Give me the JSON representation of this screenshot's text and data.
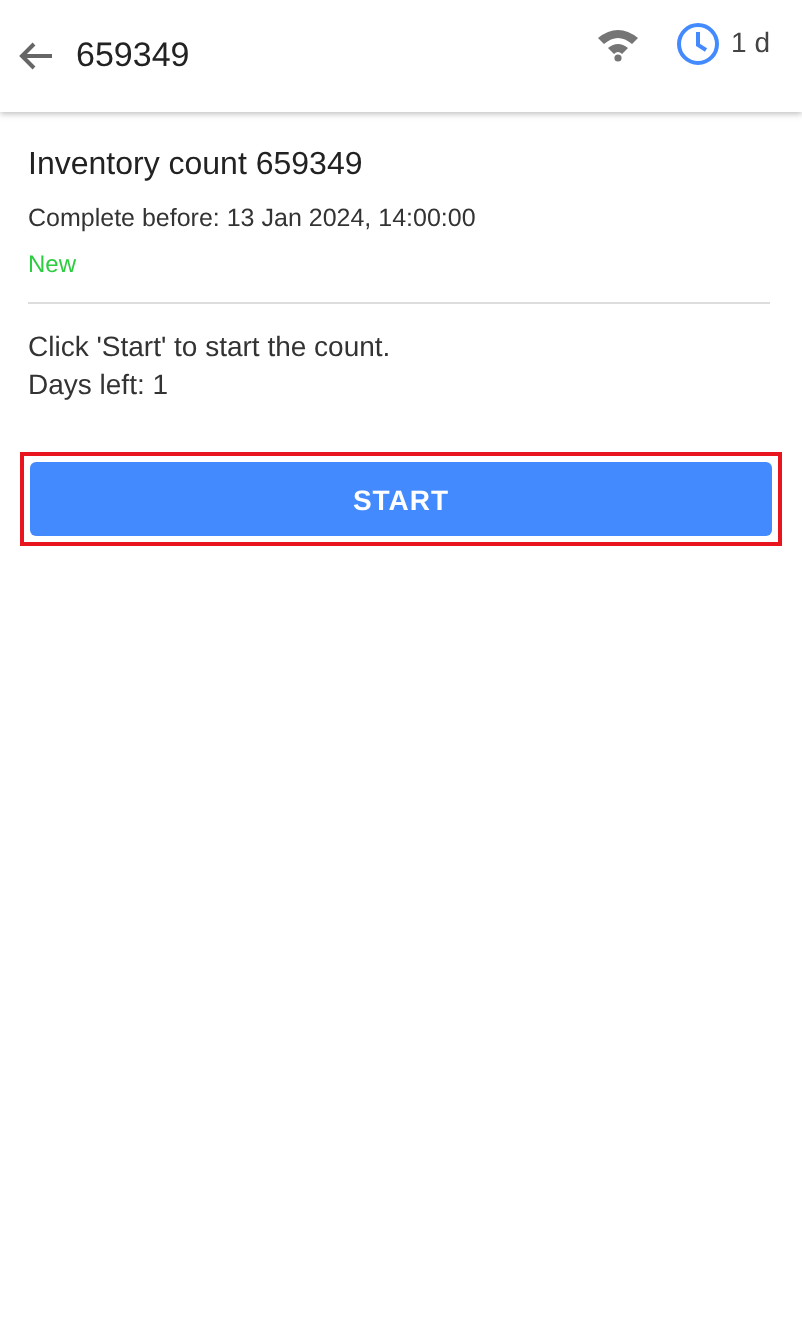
{
  "header": {
    "title": "659349",
    "time_left": "1 d"
  },
  "count": {
    "title": "Inventory count 659349",
    "deadline": "Complete before: 13 Jan 2024, 14:00:00",
    "status": {
      "label": "New",
      "color": "#2ecc40"
    }
  },
  "instructions": [
    "Click 'Start' to start the count.",
    "Days left: 1"
  ],
  "start_button": {
    "label": "START",
    "highlighted": true
  }
}
